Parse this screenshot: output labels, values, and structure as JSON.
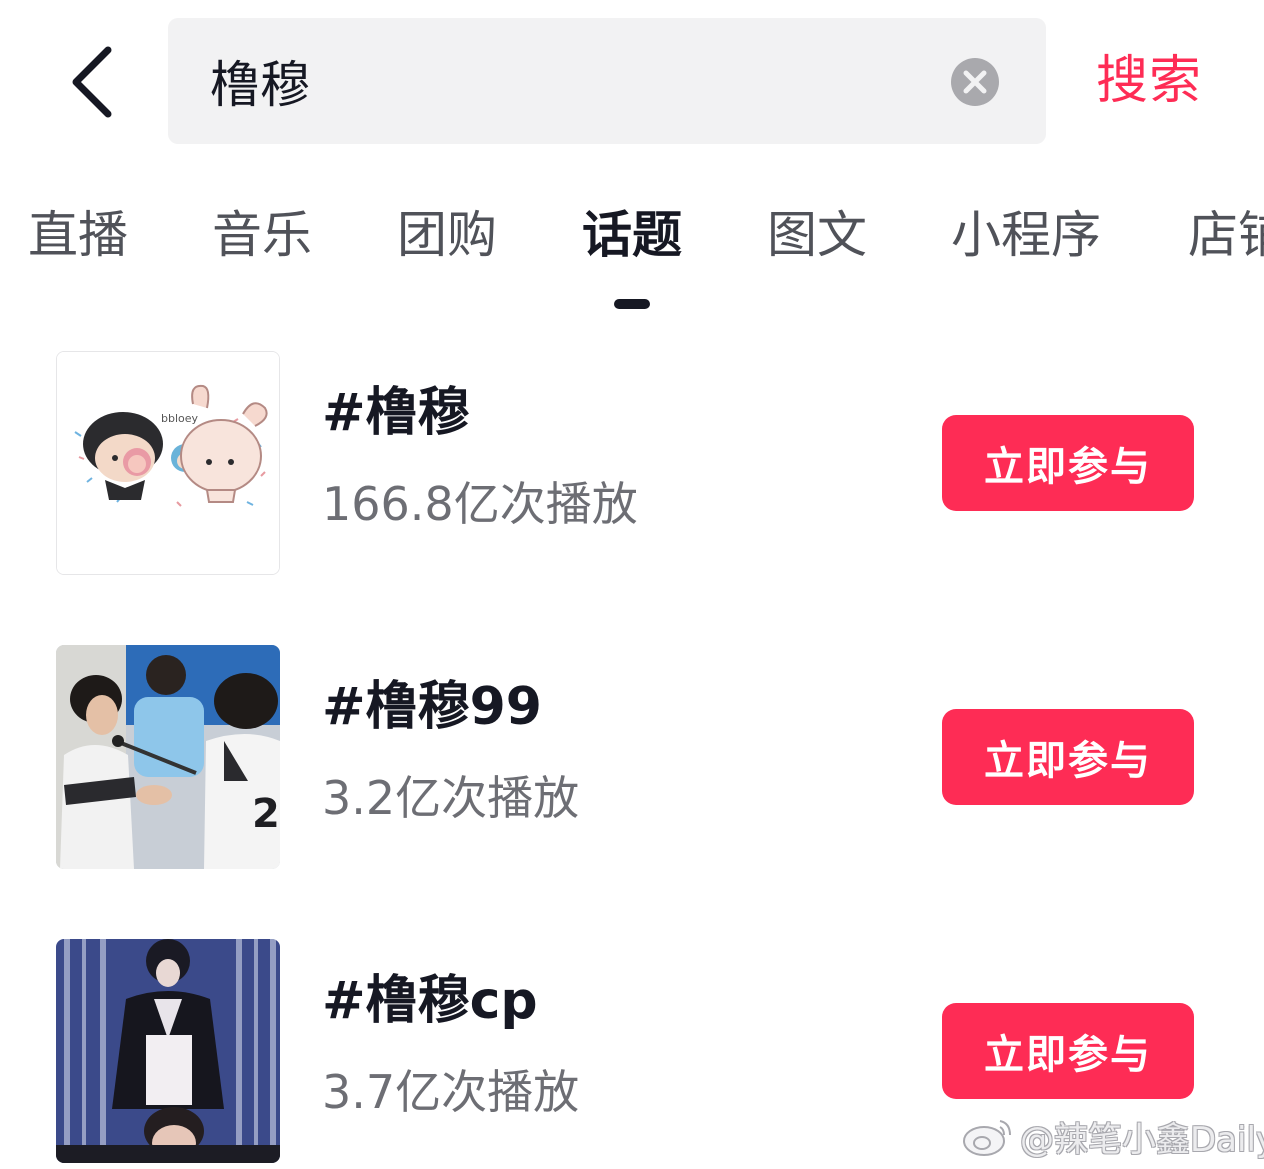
{
  "header": {
    "back_icon": "chevron-left-icon",
    "search_value": "橹穆",
    "clear_icon": "close-circle-icon",
    "search_label": "搜索",
    "accent_color": "#fe2c55"
  },
  "tabs": [
    {
      "label": "直播",
      "active": false
    },
    {
      "label": "音乐",
      "active": false
    },
    {
      "label": "团购",
      "active": false
    },
    {
      "label": "话题",
      "active": true
    },
    {
      "label": "图文",
      "active": false
    },
    {
      "label": "小程序",
      "active": false
    },
    {
      "label": "店铺",
      "active": false
    }
  ],
  "topics": [
    {
      "title": "#橹穆",
      "views": "166.8亿次播放",
      "button_label": "立即参与"
    },
    {
      "title": "#橹穆99",
      "views": "3.2亿次播放",
      "button_label": "立即参与"
    },
    {
      "title": "#橹穆cp",
      "views": "3.7亿次播放",
      "button_label": "立即参与"
    }
  ],
  "watermark": {
    "text": "@辣笔小鑫Daily",
    "icon": "weibo-logo-icon"
  }
}
